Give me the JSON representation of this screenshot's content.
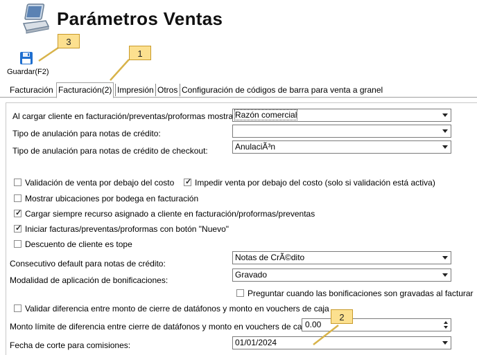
{
  "header": {
    "title": "Parámetros Ventas",
    "icon": "computer-icon"
  },
  "toolbar": {
    "save_label": "Guardar(F2)",
    "save_icon": "floppy-disk-icon"
  },
  "tabs": [
    {
      "label": "Facturación",
      "active": false
    },
    {
      "label": "Facturación(2)",
      "active": true
    },
    {
      "label": "Impresión",
      "active": false
    },
    {
      "label": "Otros",
      "active": false
    },
    {
      "label": "Configuración de códigos de barra para venta a granel",
      "active": false
    }
  ],
  "form": {
    "load_client_label": "Al cargar cliente en facturación/preventas/proformas mostrar:",
    "load_client_value": "Razón comercial",
    "credit_annul_label": "Tipo de anulación para notas de crédito:",
    "credit_annul_value": "",
    "checkout_annul_label": "Tipo de anulación para notas de crédito de checkout:",
    "checkout_annul_value": "AnulaciÃ³n",
    "validate_below_cost": {
      "label": "Validación de venta por debajo del costo",
      "checked": false
    },
    "prevent_below_cost": {
      "label": "Impedir venta por debajo del costo (solo si validación está activa)",
      "checked": true
    },
    "show_locations": {
      "label": "Mostrar ubicaciones por bodega en facturación",
      "checked": false
    },
    "load_resource": {
      "label": "Cargar siempre recurso asignado a cliente en facturación/proformas/preventas",
      "checked": true
    },
    "start_new": {
      "label": "Iniciar facturas/preventas/proformas con botón \"Nuevo\"",
      "checked": true
    },
    "client_discount": {
      "label": "Descuento de cliente es tope",
      "checked": false
    },
    "consecutive_label": "Consecutivo default para notas de crédito:",
    "consecutive_value": "Notas de CrÃ©dito",
    "bonus_mode_label": "Modalidad de aplicación de bonificaciones:",
    "bonus_mode_value": "Gravado",
    "ask_bonus": {
      "label": "Preguntar cuando las bonificaciones son gravadas al facturar",
      "checked": false
    },
    "validate_diff": {
      "label": "Validar diferencia entre monto de cierre de datáfonos y monto en vouchers de caja",
      "checked": false
    },
    "limit_label": "Monto límite de diferencia entre cierre de datáfonos y monto en vouchers de caja:",
    "limit_value": "0.00",
    "cutoff_label": "Fecha de corte para comisiones:",
    "cutoff_value": "01/01/2024"
  },
  "callouts": {
    "one": "1",
    "two": "2",
    "three": "3"
  },
  "colors": {
    "callout_fill": "#fce08f",
    "callout_border": "#c89a2a",
    "save_icon": "#1f6fd0"
  }
}
